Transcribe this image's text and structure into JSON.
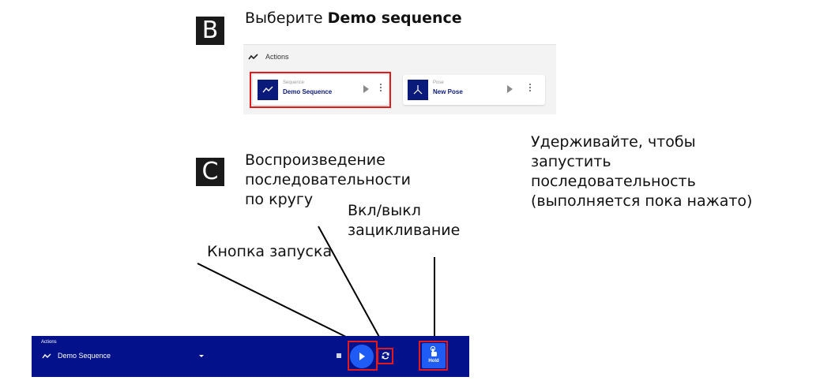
{
  "section_b": {
    "badge": "B",
    "caption_prefix": "Выберите ",
    "caption_bold": "Demo sequence",
    "panel_title": "Actions",
    "cards": [
      {
        "type": "Sequence",
        "name": "Demo Sequence",
        "icon": "trend-line-icon",
        "highlighted": true
      },
      {
        "type": "Pose",
        "name": "New Pose",
        "icon": "pose-axes-icon",
        "highlighted": false
      }
    ]
  },
  "section_c": {
    "badge": "C",
    "callouts": {
      "loop_playback": [
        "Воспроизведение",
        "последовательности",
        "по кругу"
      ],
      "loop_toggle": [
        "Вкл/выкл",
        "зацикливание"
      ],
      "start_button": "Кнопка запуска",
      "hold": [
        "Удерживайте, чтобы",
        "запустить",
        "последовательность",
        "(выполняется пока нажато)"
      ]
    },
    "bar": {
      "label": "Actions",
      "selected_sequence": "Demo Sequence",
      "hold_label": "Hold"
    }
  },
  "colors": {
    "bar_bg": "#03128a",
    "accent_blue": "#1e5cf5",
    "highlight_red": "#e11b1b",
    "badge_bg": "#1a1a1a"
  }
}
